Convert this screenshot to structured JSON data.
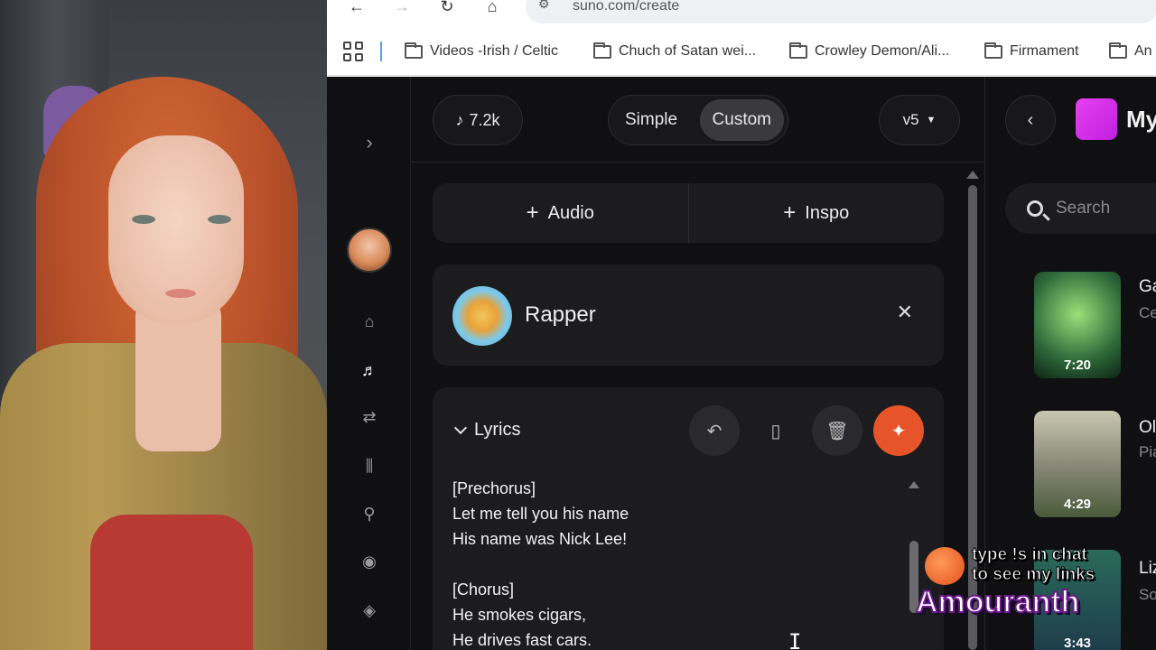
{
  "browser": {
    "url": "suno.com/create",
    "bookmarks": [
      "Videos -Irish / Celtic",
      "Chuch of Satan wei...",
      "Crowley Demon/Ali...",
      "Firmament",
      "An"
    ]
  },
  "topbar": {
    "credits": "7.2k",
    "mode_simple": "Simple",
    "mode_custom": "Custom",
    "model": "v5"
  },
  "add": {
    "audio": "Audio",
    "inspo": "Inspo"
  },
  "persona": {
    "name": "Rapper"
  },
  "lyrics": {
    "label": "Lyrics",
    "text": "[Prechorus]\nLet me tell you his name\nHis name was Nick Lee!\n\n[Chorus]\nHe smokes cigars,\nHe drives fast cars."
  },
  "workspace": {
    "title": "My",
    "search_placeholder": "Search"
  },
  "songs": [
    {
      "title": "Ga",
      "subtitle": "Ce",
      "duration": "7:20"
    },
    {
      "title": "Ol",
      "subtitle": "Pia",
      "duration": "4:29"
    },
    {
      "title": "Liz",
      "subtitle": "So",
      "duration": "3:43"
    }
  ],
  "overlay": {
    "line1": "type !s in chat",
    "line2": "to see my links",
    "name": "Amouranth"
  },
  "colors": {
    "accent": "#e8542a",
    "workspace": "#e640f0",
    "background": "#101012"
  }
}
